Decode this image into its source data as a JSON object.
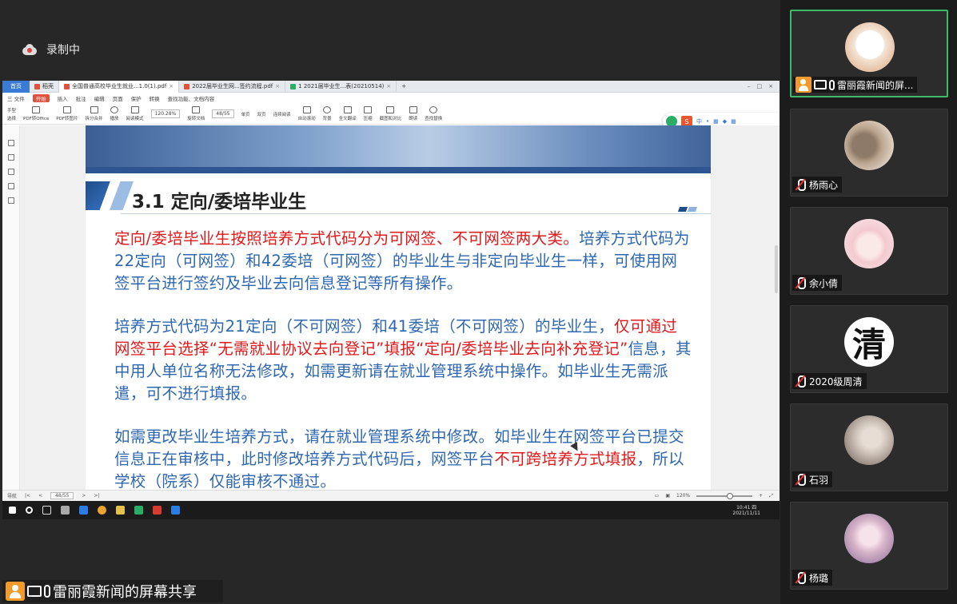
{
  "recording": {
    "label": "录制中"
  },
  "share": {
    "label": "雷丽霞新闻的屏幕共享"
  },
  "app": {
    "tabs": [
      {
        "label": "首页"
      },
      {
        "label": "稻壳"
      },
      {
        "label": "全国普通高校毕业生就业...1.0(1).pdf"
      },
      {
        "label": "2022届毕业生网...签约流程.pdf"
      },
      {
        "label": "1 2021届毕业生...表(20210514)"
      }
    ],
    "menu": [
      "三 文件",
      "开始",
      "插入",
      "批注",
      "编辑",
      "页面",
      "保护",
      "转换",
      "查找功能、文档内容"
    ],
    "toolbar": [
      "手型",
      "选择",
      "PDF转Office",
      "PDF转图片",
      "拆分合并",
      "播放",
      "阅读模式",
      "旋转文档",
      "单页",
      "双页",
      "连续阅读",
      "自动滚动",
      "背景",
      "全文翻译",
      "压缩",
      "截图和对比",
      "朗读",
      "查找替换"
    ],
    "zoom": "120.28%",
    "page": "48/55",
    "float_tools": "中",
    "status": {
      "nav": "导航",
      "page": "48/55",
      "zoom": "120%"
    },
    "clock": {
      "time": "10:41 四",
      "date": "2021/11/11"
    }
  },
  "document": {
    "heading": "3.1 定向/委培毕业生",
    "para1_red": "定向/委培毕业生按照培养方式代码分为可网签、不可网签两大类。",
    "para1_blue": "培养方式代码为22定向（可网签）和42委培（可网签）的毕业生与非定向毕业生一样，可使用网签平台进行签约及毕业去向信息登记等所有操作。",
    "para2_blue_a": "培养方式代码为21定向（不可网签）和41委培（不可网签）的毕业生，",
    "para2_red": "仅可通过网签平台选择“无需就业协议去向登记”填报“定向/委培毕业去向补充登记”",
    "para2_blue_b": "信息，其中用人单位名称无法修改，如需更新请在就业管理系统中操作。如毕业生无需派遣，可不进行填报。",
    "para3_blue_a": "如需更改毕业生培养方式，请在就业管理系统中修改。如毕业生在网签平台已提交信息正在审核中，此时修改培养方式代码后，网签平台",
    "para3_red": "不可跨培养方式填报",
    "para3_blue_b": "，所以学校（院系）仅能审核不通过。"
  },
  "participants": [
    {
      "name": "雷丽霞新闻的屏...",
      "sharing": true,
      "avatar_color": "#f3e6d8"
    },
    {
      "name": "杨雨心",
      "muted": true,
      "avatar_color": "#b9a48e"
    },
    {
      "name": "余小倩",
      "muted": true,
      "avatar_color": "#f4c9d0"
    },
    {
      "name": "2020级周清",
      "muted": true,
      "avatar_char": "清"
    },
    {
      "name": "石羽",
      "muted": true,
      "avatar_color": "#c9bdb3"
    },
    {
      "name": "杨璐",
      "muted": true,
      "avatar_color": "#d7b3c8"
    }
  ],
  "colors": {
    "accent_green": "#3fb96a",
    "doc_blue": "#2e67b1",
    "doc_red": "#e0191b",
    "share_orange": "#f29b2a"
  }
}
